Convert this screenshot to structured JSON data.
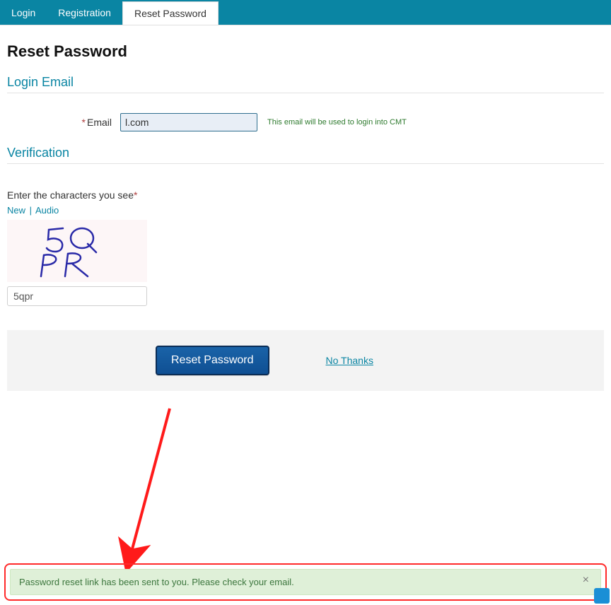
{
  "tabs": {
    "login": "Login",
    "registration": "Registration",
    "reset": "Reset Password"
  },
  "page_title": "Reset Password",
  "section_login_email": "Login Email",
  "email_field": {
    "label": "Email",
    "value": "l.com",
    "help": "This email will be used to login into CMT"
  },
  "section_verification": "Verification",
  "captcha": {
    "label": "Enter the characters you see",
    "new": "New",
    "audio": "Audio",
    "input_value": "5qpr"
  },
  "actions": {
    "reset_btn": "Reset Password",
    "no_thanks": "No Thanks"
  },
  "alert": {
    "text": "Password reset link has been sent to you. Please check your email.",
    "close": "×"
  }
}
